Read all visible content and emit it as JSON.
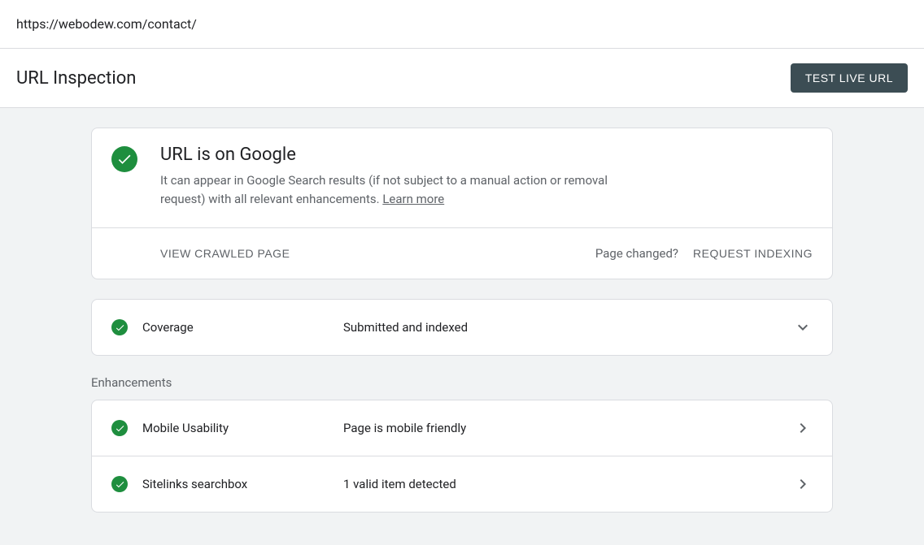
{
  "url_bar": {
    "url": "https://webodew.com/contact/"
  },
  "header": {
    "title": "URL Inspection",
    "test_button": "TEST LIVE URL"
  },
  "status": {
    "heading": "URL is on Google",
    "description": "It can appear in Google Search results (if not subject to a manual action or removal request) with all relevant enhancements. ",
    "learn_more": "Learn more",
    "view_crawled": "VIEW CRAWLED PAGE",
    "page_changed": "Page changed?",
    "request_indexing": "REQUEST INDEXING"
  },
  "coverage": {
    "label": "Coverage",
    "value": "Submitted and indexed"
  },
  "enhancements_label": "Enhancements",
  "enhancements": [
    {
      "label": "Mobile Usability",
      "value": "Page is mobile friendly"
    },
    {
      "label": "Sitelinks searchbox",
      "value": "1 valid item detected"
    }
  ]
}
